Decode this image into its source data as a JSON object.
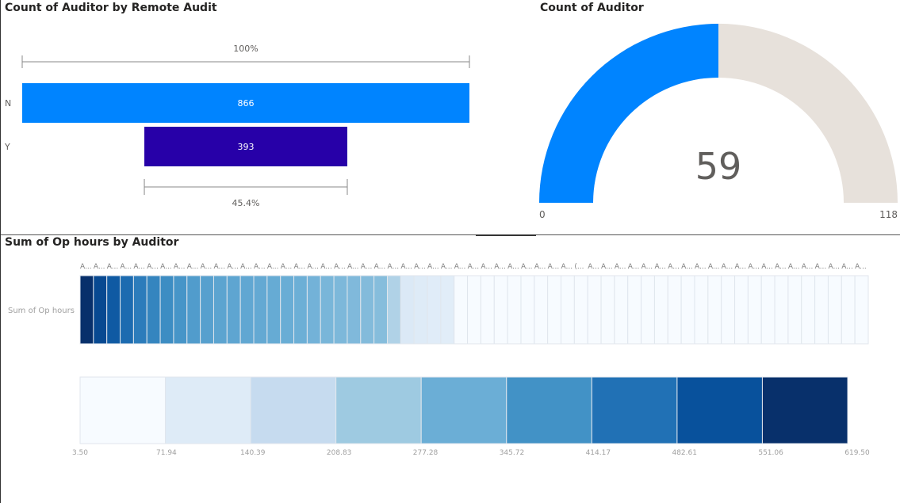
{
  "charts": {
    "funnel": {
      "title": "Count of Auditor by Remote Audit"
    },
    "gauge": {
      "title": "Count of Auditor"
    },
    "heatmap": {
      "title": "Sum of Op hours by Auditor"
    }
  },
  "colors": {
    "bar_n": "#0084FF",
    "bar_y": "#2700A8",
    "gauge_fill": "#0084FF",
    "gauge_track": "#E7E1DB",
    "cell_border": "#E0E6ED"
  },
  "chart_data": [
    {
      "type": "bar",
      "orientation": "horizontal",
      "title": "Count of Auditor by Remote Audit",
      "categories": [
        "N",
        "Y"
      ],
      "values": [
        866,
        393
      ],
      "data_labels": [
        "866",
        "393"
      ],
      "annotations": {
        "top": "100%",
        "bottom": "45.4%"
      }
    },
    {
      "type": "gauge",
      "title": "Count of Auditor",
      "value": 59,
      "min": 0,
      "max": 118,
      "value_label": "59",
      "min_label": "0",
      "max_label": "118"
    },
    {
      "type": "heatmap",
      "title": "Sum of Op hours by Auditor",
      "row_label": "Sum of Op hours",
      "column_labels": [
        "A...",
        "A...",
        "A...",
        "A...",
        "A...",
        "A...",
        "A...",
        "A...",
        "A...",
        "A...",
        "A...",
        "A...",
        "A...",
        "A...",
        "A...",
        "A...",
        "A...",
        "A...",
        "A...",
        "A...",
        "A...",
        "A...",
        "A...",
        "A...",
        "A...",
        "A...",
        "A...",
        "A...",
        "A...",
        "A...",
        "A...",
        "A...",
        "A...",
        "A...",
        "A...",
        "A...",
        "A...",
        "(...",
        "A...",
        "A...",
        "A...",
        "A...",
        "A...",
        "A...",
        "A...",
        "A...",
        "A...",
        "A...",
        "A...",
        "A...",
        "A...",
        "A...",
        "A...",
        "A...",
        "A...",
        "A...",
        "A...",
        "A...",
        "A..."
      ],
      "values": [
        619.5,
        560,
        520,
        480,
        440,
        420,
        400,
        380,
        360,
        350,
        340,
        335,
        330,
        325,
        320,
        315,
        310,
        300,
        290,
        285,
        280,
        275,
        270,
        200,
        90,
        80,
        75,
        70,
        3.5,
        3.5,
        3.5,
        3.5,
        3.5,
        3.5,
        3.5,
        3.5,
        3.5,
        3.5,
        3.5,
        3.5,
        3.5,
        3.5,
        3.5,
        3.5,
        3.5,
        3.5,
        3.5,
        3.5,
        3.5,
        3.5,
        3.5,
        3.5,
        3.5,
        3.5,
        3.5,
        3.5,
        3.5,
        3.5,
        3.5
      ],
      "legend": {
        "type": "gradient",
        "stops": [
          "#F7FBFF",
          "#DEEBF7",
          "#C6DBEF",
          "#9ECAE1",
          "#6BAED6",
          "#4292C6",
          "#2171B5",
          "#08519C",
          "#08306B"
        ],
        "tick_labels": [
          "3.50",
          "71.94",
          "140.39",
          "208.83",
          "277.28",
          "345.72",
          "414.17",
          "482.61",
          "551.06",
          "619.50"
        ],
        "min": 3.5,
        "max": 619.5
      }
    }
  ]
}
